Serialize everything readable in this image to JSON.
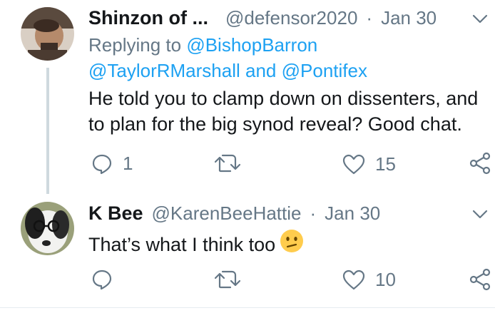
{
  "tweets": [
    {
      "display_name": "Shinzon of ...",
      "handle": "@defensor2020",
      "separator": "·",
      "date": "Jan 30",
      "replying_prefix": "Replying to",
      "mention_1": "@BishopBarron",
      "mention_2": "@TaylorRMarshall",
      "mention_join": "and",
      "mention_3": "@Pontifex",
      "text_line_1": "He told you to clamp down on dissenters, and",
      "text_line_2": "to plan for the big synod reveal? Good chat.",
      "reply_count": "1",
      "retweet_count": "",
      "like_count": "15"
    },
    {
      "display_name": "K Bee",
      "handle": "@KarenBeeHattie",
      "separator": "·",
      "date": "Jan 30",
      "text": "That’s what I think too",
      "emoji": "confused-face-emoji",
      "reply_count": "",
      "retweet_count": "",
      "like_count": "10"
    }
  ],
  "icons": {
    "reply": "reply-icon",
    "retweet": "retweet-icon",
    "like": "heart-icon",
    "share": "share-icon",
    "menu": "chevron-down-icon"
  },
  "colors": {
    "text": "#14171a",
    "muted": "#657786",
    "link": "#1da1f2",
    "thread_line": "#cfd9de"
  }
}
